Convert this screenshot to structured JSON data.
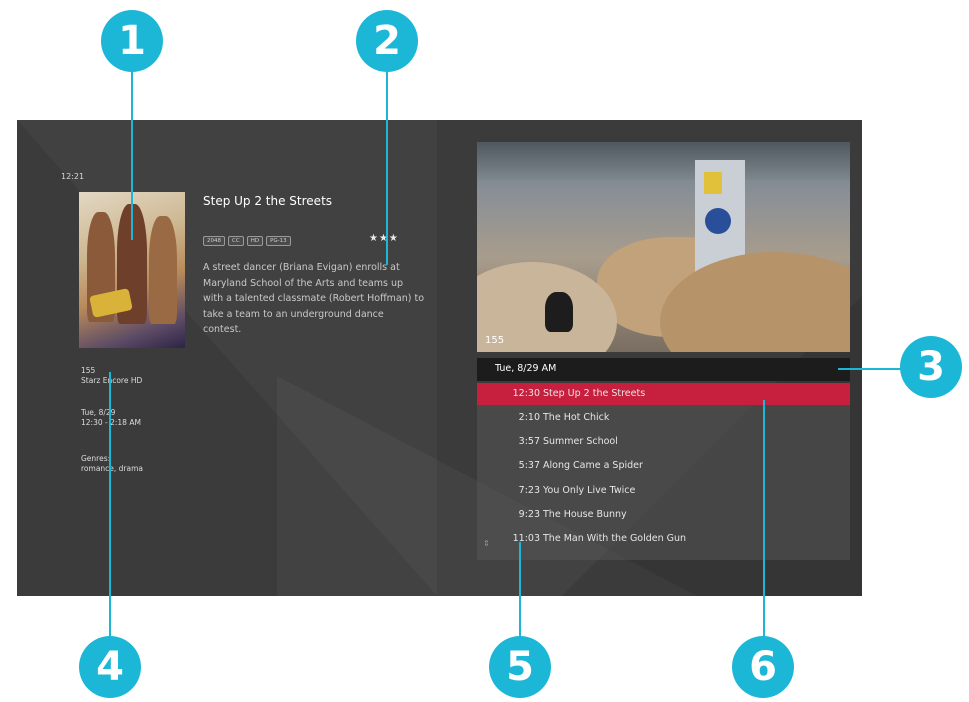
{
  "callouts": [
    "1",
    "2",
    "3",
    "4",
    "5",
    "6"
  ],
  "clock": "12:21",
  "program": {
    "title": "Step Up 2 the Streets",
    "tags": [
      "2048",
      "CC",
      "HD",
      "PG-13"
    ],
    "rating_stars": "★★★",
    "description": "A street dancer (Briana Evigan) enrolls at Maryland School of the Arts and teams up with a talented classmate (Robert Hoffman) to take a team to an underground dance contest.",
    "channel_number": "155",
    "channel_name": "Starz Encore HD",
    "date": "Tue, 8/29",
    "time_range": "12:30 - 2:18 AM",
    "genres_label": "Genres:",
    "genres": "romance, drama"
  },
  "video": {
    "channel": "155"
  },
  "schedule": {
    "header": "Tue, 8/29  AM",
    "rows": [
      {
        "time": "12:30",
        "title": "Step Up 2 the Streets",
        "selected": true
      },
      {
        "time": "2:10",
        "title": "The Hot Chick"
      },
      {
        "time": "3:57",
        "title": "Summer School"
      },
      {
        "time": "5:37",
        "title": "Along Came a Spider"
      },
      {
        "time": "7:23",
        "title": "You Only Live Twice"
      },
      {
        "time": "9:23",
        "title": "The House Bunny"
      },
      {
        "time": "11:03",
        "title": "The Man With the Golden Gun"
      }
    ],
    "scroll_icon": "up-down-arrows-icon"
  },
  "colors": {
    "accent": "#1cb7d6",
    "selected": "#c7203f",
    "background": "#3b3b3b"
  }
}
